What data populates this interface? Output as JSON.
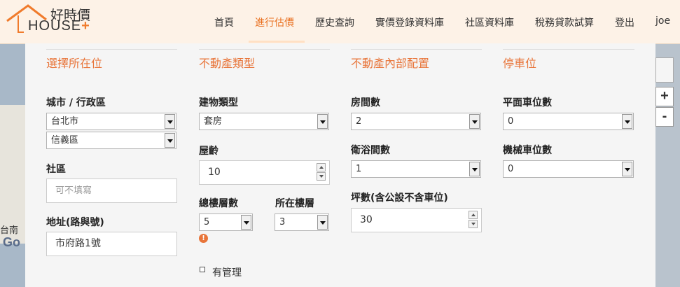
{
  "header": {
    "logo_cn": "好時價",
    "logo_en": "HOUSE",
    "logo_plus": "+",
    "nav": [
      "首頁",
      "進行估價",
      "歷史查詢",
      "實價登錄資料庫",
      "社區資料庫",
      "稅務貸款試算",
      "登出",
      "joe"
    ],
    "active_nav": "進行估價"
  },
  "map": {
    "label": "台南",
    "brand": "Go",
    "zoom_in": "+",
    "zoom_out": "-"
  },
  "sections": {
    "location": {
      "title": "選擇所在位",
      "city_label": "城市 / 行政區",
      "city_value": "台北市",
      "district_value": "信義區",
      "community_label": "社區",
      "community_placeholder": "可不填寫",
      "address_label": "地址(路與號)",
      "address_value": "市府路1號"
    },
    "type": {
      "title": "不動產類型",
      "building_label": "建物類型",
      "building_value": "套房",
      "age_label": "屋齡",
      "age_value": "10",
      "total_floors_label": "總樓層數",
      "total_floors_value": "5",
      "floor_label": "所在樓層",
      "floor_value": "3",
      "info_icon": "!",
      "managed_label": "有管理"
    },
    "layout": {
      "title": "不動產內部配置",
      "rooms_label": "房間數",
      "rooms_value": "2",
      "baths_label": "衛浴間數",
      "baths_value": "1",
      "area_label": "坪數(含公設不含車位)",
      "area_value": "30"
    },
    "parking": {
      "title": "停車位",
      "flat_label": "平面車位數",
      "flat_value": "0",
      "mech_label": "機械車位數",
      "mech_value": "0"
    }
  },
  "colors": {
    "accent": "#e8753a",
    "header_bg": "#fdf2e7",
    "panel_bg": "#f5f5f5"
  }
}
